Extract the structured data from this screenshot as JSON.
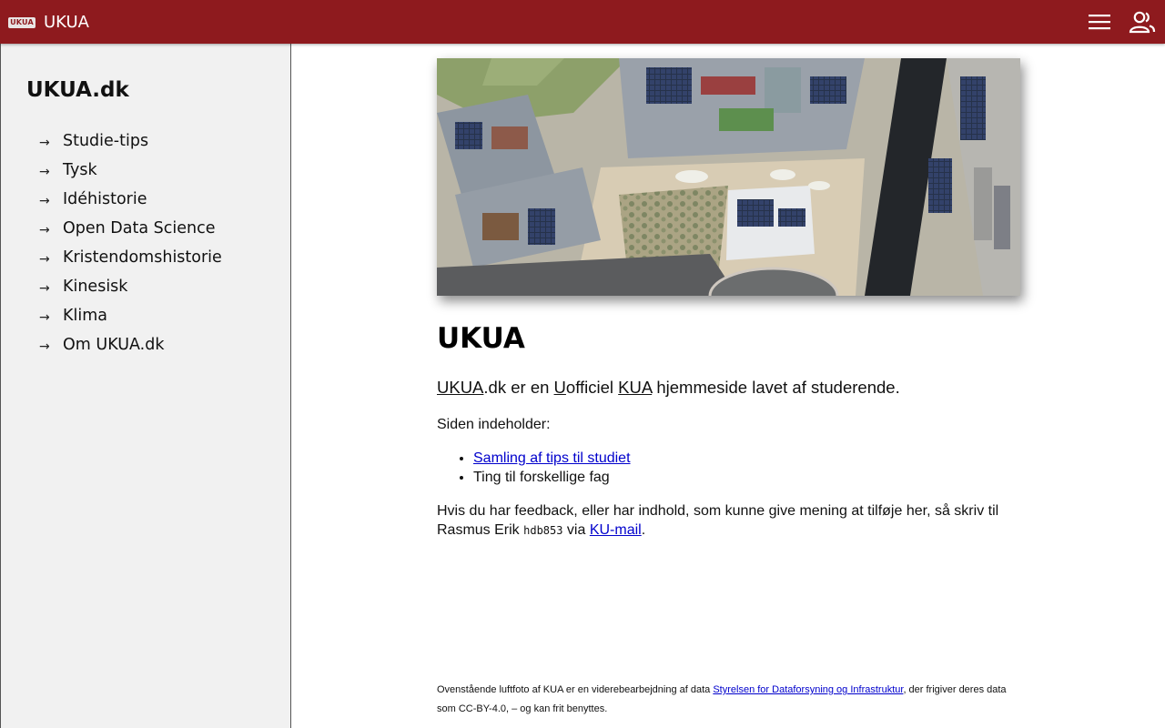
{
  "header": {
    "logo_text": "UKUA",
    "title": "UKUA",
    "menu_icon": "hamburger-menu-icon",
    "user_icon": "user-group-icon",
    "bar_color": "#8e1a1e"
  },
  "sidebar": {
    "title": "UKUA.dk",
    "arrow": "→",
    "items": [
      {
        "label": "Studie-tips"
      },
      {
        "label": "Tysk"
      },
      {
        "label": "Idéhistorie"
      },
      {
        "label": "Open Data Science"
      },
      {
        "label": "Kristendomshistorie"
      },
      {
        "label": "Kinesisk"
      },
      {
        "label": "Klima"
      },
      {
        "label": "Om UKUA.dk"
      }
    ]
  },
  "main": {
    "hero_image": "aerial-campus-photo",
    "title": "UKUA",
    "lead": {
      "w1": "UKUA",
      "t1": ".dk er en ",
      "w2": "U",
      "t2": "officiel ",
      "w3": "KUA",
      "t3": " hjemmeside lavet af studerende."
    },
    "contains_label": "Siden indeholder:",
    "bullets": {
      "link": "Samling af tips til studiet",
      "text": "Ting til forskellige fag"
    },
    "feedback": {
      "text": "Hvis du har feedback, eller har indhold, som kunne give mening at tilføje her, så skriv til Rasmus Erik ",
      "code": "hdb853",
      "via": " via ",
      "link": "KU-mail",
      "end": "."
    },
    "footnote": {
      "text1": "Ovenstående luftfoto af KUA er en viderebearbejdning af data ",
      "link": "Styrelsen for Dataforsyning og Infrastruktur",
      "text2": ", der frigiver deres data som CC-BY-4.0, – og kan frit benyttes."
    }
  }
}
